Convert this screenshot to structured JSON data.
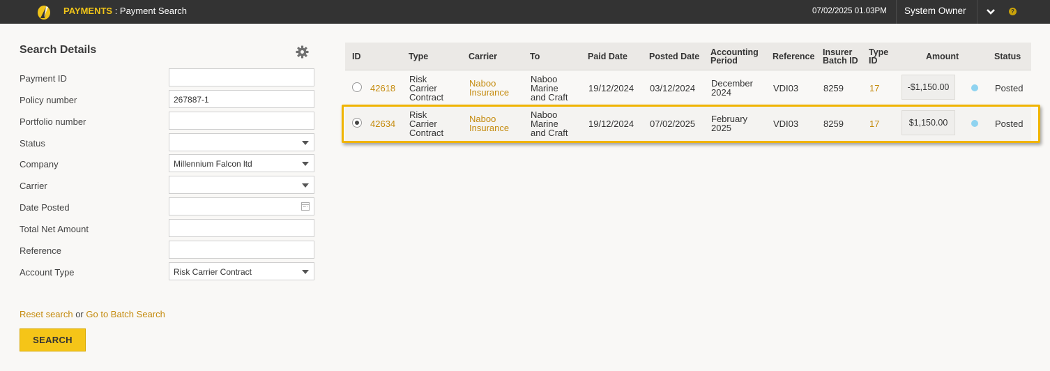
{
  "header": {
    "module": "PAYMENTS",
    "separator": " : ",
    "page": "Payment Search",
    "datetime": "07/02/2025 01.03PM",
    "user": "System Owner",
    "help": "?"
  },
  "search": {
    "title": "Search Details",
    "fields": [
      {
        "label": "Payment ID",
        "value": ""
      },
      {
        "label": "Policy number",
        "value": "267887-1"
      },
      {
        "label": "Portfolio number",
        "value": ""
      },
      {
        "label": "Status",
        "value": ""
      },
      {
        "label": "Company",
        "value": "Millennium Falcon ltd"
      },
      {
        "label": "Carrier",
        "value": ""
      },
      {
        "label": "Date Posted",
        "value": ""
      },
      {
        "label": "Total Net Amount",
        "value": ""
      },
      {
        "label": "Reference",
        "value": ""
      },
      {
        "label": "Account Type",
        "value": "Risk Carrier Contract"
      }
    ],
    "reset_link": "Reset search",
    "or_text": " or ",
    "batch_link": "Go to Batch Search",
    "search_button": "SEARCH"
  },
  "results": {
    "columns": {
      "id": "ID",
      "type": "Type",
      "carrier": "Carrier",
      "to": "To",
      "paid_date": "Paid Date",
      "posted_date": "Posted Date",
      "accounting_period_1": "Accounting",
      "accounting_period_2": "Period",
      "reference": "Reference",
      "insurer_batch_1": "Insurer",
      "insurer_batch_2": "Batch ID",
      "type_id_1": "Type",
      "type_id_2": "ID",
      "amount": "Amount",
      "status": "Status"
    },
    "rows": [
      {
        "selected": false,
        "id": "42618",
        "type_1": "Risk",
        "type_2": "Carrier",
        "type_3": "Contract",
        "carrier_1": "Naboo",
        "carrier_2": "Insurance",
        "to_1": "Naboo",
        "to_2": "Marine",
        "to_3": "and Craft",
        "paid_date": "19/12/2024",
        "posted_date": "03/12/2024",
        "period_1": "December",
        "period_2": "2024",
        "reference": "VDI03",
        "batch_id": "8259",
        "type_id": "17",
        "amount": "-$1,150.00",
        "status": "Posted"
      },
      {
        "selected": true,
        "id": "42634",
        "type_1": "Risk",
        "type_2": "Carrier",
        "type_3": "Contract",
        "carrier_1": "Naboo",
        "carrier_2": "Insurance",
        "to_1": "Naboo",
        "to_2": "Marine",
        "to_3": "and Craft",
        "paid_date": "19/12/2024",
        "posted_date": "07/02/2025",
        "period_1": "February",
        "period_2": "2025",
        "reference": "VDI03",
        "batch_id": "8259",
        "type_id": "17",
        "amount": "$1,150.00",
        "status": "Posted"
      }
    ]
  },
  "colors": {
    "topbar": "#333333",
    "accent": "#f0c419",
    "link": "#c48a0c",
    "status_dot": "#8fd3f0",
    "highlight": "#f0b400"
  }
}
